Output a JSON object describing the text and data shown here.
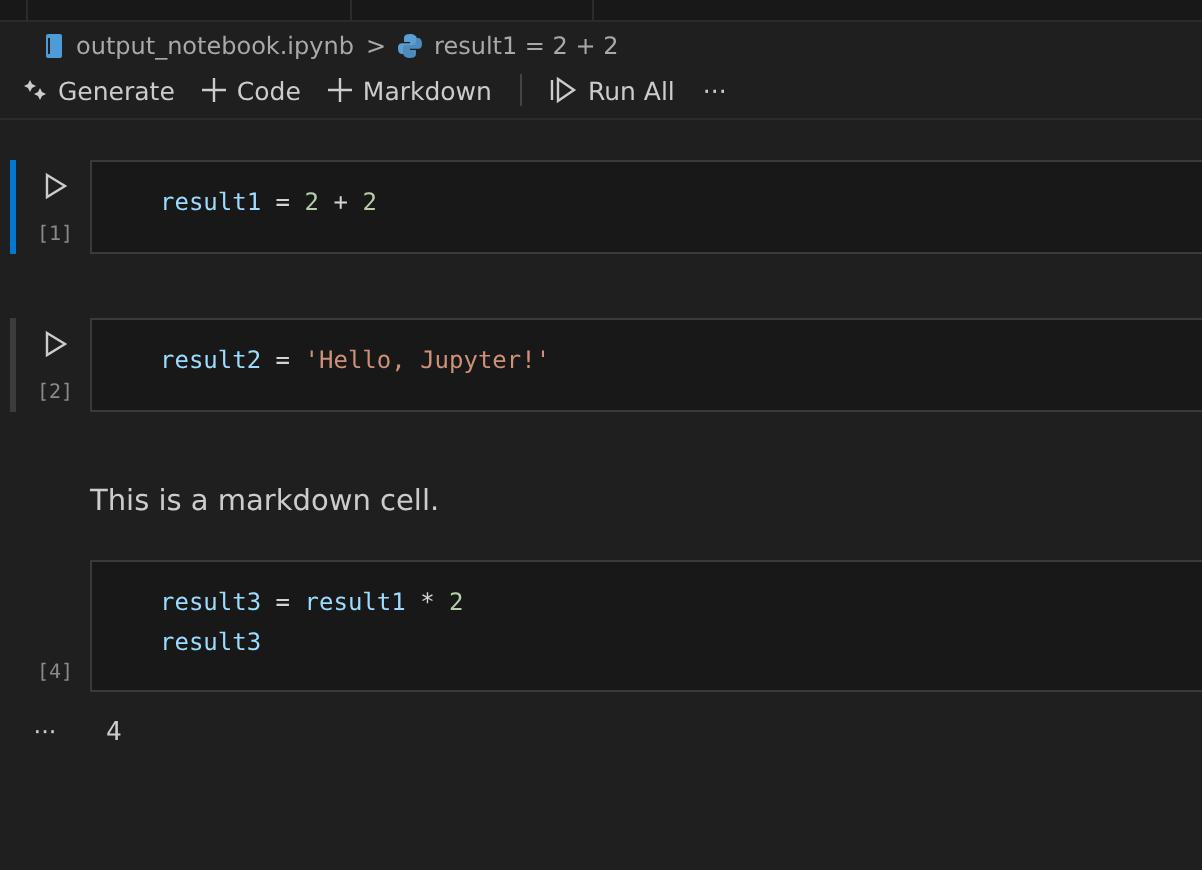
{
  "breadcrumb": [
    {
      "kind": "notebook",
      "label": "output_notebook.ipynb"
    },
    {
      "kind": "python",
      "label": "result1 = 2 + 2"
    }
  ],
  "breadcrumb_separator": ">",
  "toolbar": [
    {
      "kind": "sparkle",
      "label": "Generate"
    },
    {
      "kind": "plus",
      "label": "Code"
    },
    {
      "kind": "plus",
      "label": "Markdown"
    },
    {
      "kind": "divider"
    },
    {
      "kind": "run",
      "label": "Run All"
    },
    {
      "kind": "more",
      "label": "···"
    }
  ],
  "cells": [
    {
      "kind": "code",
      "selected": true,
      "hovered": false,
      "count": "[1]",
      "lines": [
        [
          {
            "kind": "var",
            "s": "result1"
          },
          {
            "kind": "op",
            "s": " = "
          },
          {
            "kind": "num",
            "s": "2"
          },
          {
            "kind": "op",
            "s": " + "
          },
          {
            "kind": "num",
            "s": "2"
          }
        ]
      ]
    },
    {
      "kind": "code",
      "selected": false,
      "hovered": true,
      "count": "[2]",
      "lines": [
        [
          {
            "kind": "var",
            "s": "result2"
          },
          {
            "kind": "op",
            "s": " = "
          },
          {
            "kind": "str",
            "s": "'Hello, Jupyter!'"
          }
        ]
      ]
    },
    {
      "kind": "markdown",
      "text": "This is a markdown cell."
    },
    {
      "kind": "code",
      "selected": false,
      "hovered": false,
      "count": "[4]",
      "lines": [
        [
          {
            "kind": "var",
            "s": "result3"
          },
          {
            "kind": "op",
            "s": " = "
          },
          {
            "kind": "var",
            "s": "result1"
          },
          {
            "kind": "op",
            "s": " * "
          },
          {
            "kind": "num",
            "s": "2"
          }
        ],
        [
          {
            "kind": "var",
            "s": "result3"
          }
        ]
      ],
      "output": {
        "more": "···",
        "text": "4"
      }
    }
  ]
}
